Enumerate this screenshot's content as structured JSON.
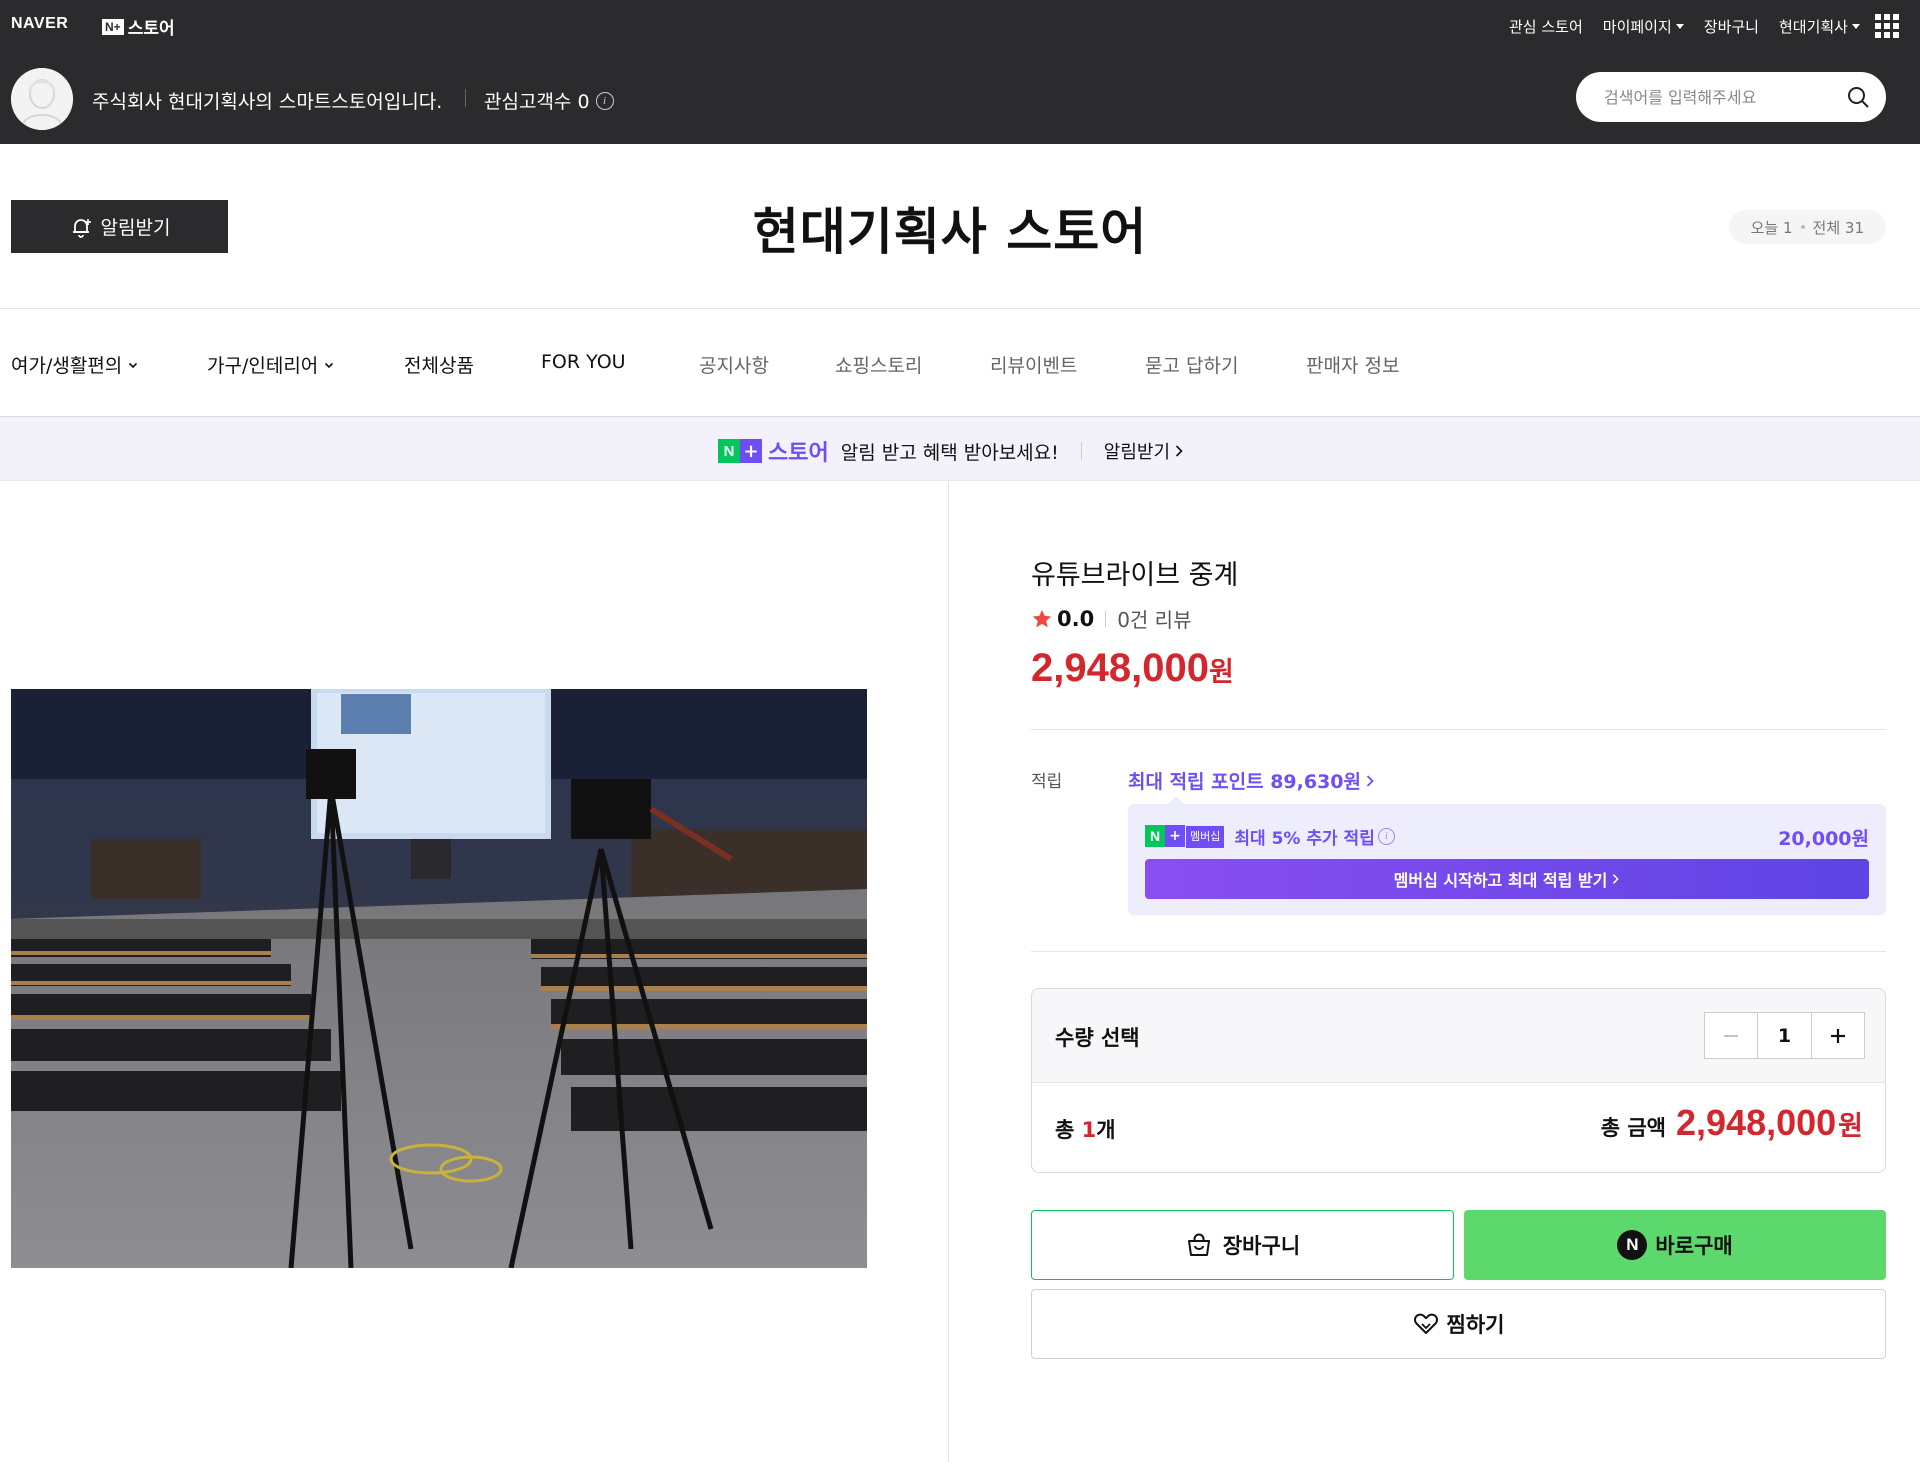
{
  "gnb": {
    "naver_logo": "NAVER",
    "nplus_box": "N+",
    "nplus_text": "스토어",
    "links": [
      {
        "label": "관심 스토어"
      },
      {
        "label": "마이페이지"
      },
      {
        "label": "장바구니"
      },
      {
        "label": "현대기획사"
      }
    ]
  },
  "store_bar": {
    "description": "주식회사 현대기획사의 스마트스토어입니다.",
    "fans": "관심고객수 0",
    "search_placeholder": "검색어를 입력해주세요"
  },
  "store_header": {
    "notify_label": "알림받기",
    "title": "현대기획사 스토어",
    "today": "오늘 1",
    "total": "전체 31"
  },
  "nav": {
    "items": [
      {
        "label": "여가/생활편의"
      },
      {
        "label": "가구/인테리어"
      },
      {
        "label": "전체상품"
      },
      {
        "label": "FOR YOU"
      },
      {
        "label": "공지사항"
      },
      {
        "label": "쇼핑스토리"
      },
      {
        "label": "리뷰이벤트"
      },
      {
        "label": "묻고 답하기"
      },
      {
        "label": "판매자 정보"
      }
    ]
  },
  "banner": {
    "n": "N",
    "plus": "+",
    "store": "스토어",
    "message": "알림 받고 혜택 받아보세요!",
    "cta": "알림받기"
  },
  "product": {
    "title": "유튜브라이브 중계",
    "rating": "0.0",
    "reviews": "0건 리뷰",
    "price": "2,948,000",
    "won": "원",
    "point_label": "적립",
    "point_link": "최대 적립 포인트 89,630원",
    "member_tag": "멤버십",
    "member_text": "최대 5% 추가 적립",
    "member_amount": "20,000원",
    "member_button": "멤버십 시작하고 최대 적립 받기",
    "qty_label": "수량 선택",
    "qty_value": "1",
    "total_prefix": "총 ",
    "total_count": "1",
    "total_suffix": "개",
    "total_amount_label": "총 금액",
    "total_amount": "2,948,000",
    "cart_label": "장바구니",
    "buy_label": "바로구매",
    "wish_label": "찜하기"
  },
  "colors": {
    "topbar": "#2b2b2d",
    "naver_green": "#03c75a",
    "price_red": "#d4262d",
    "membership_purple": "#6f4ef6",
    "buy_green": "#5dd86d"
  }
}
